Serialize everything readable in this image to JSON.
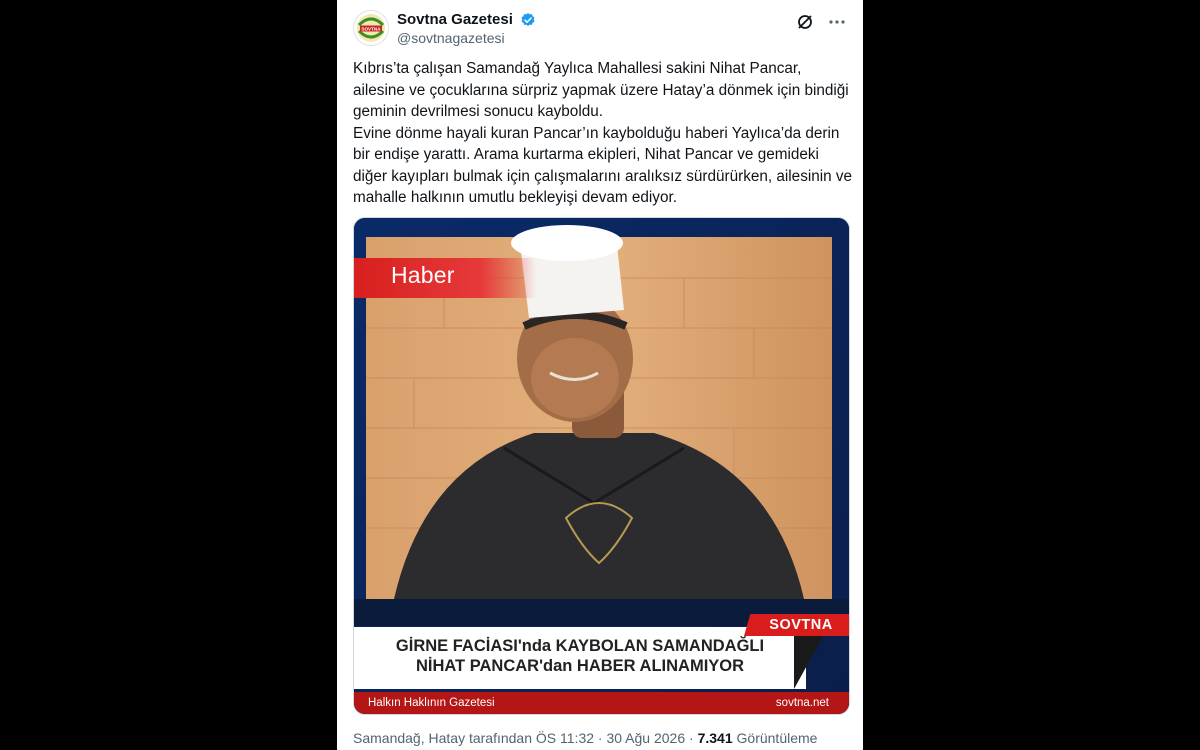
{
  "tweet": {
    "display_name": "Sovtna Gazetesi",
    "handle": "@sovtnagazetesi",
    "avatar_text": "SOVTNA",
    "paragraphs": [
      "Kıbrıs’ta çalışan Samandağ Yaylıca Mahallesi sakini Nihat Pancar, ailesine ve çocuklarına sürpriz yapmak üzere Hatay’a dönmek için bindiği geminin devrilmesi sonucu kayboldu.",
      "Evine dönme hayali kuran Pancar’ın kaybolduğu haberi Yaylıca’da derin bir endişe yarattı. Arama kurtarma ekipleri, Nihat Pancar ve gemideki diğer kayıpları bulmak için çalışmalarını aralıksız sürdürürken, ailesinin ve mahalle halkının umutlu bekleyişi devam ediyor."
    ],
    "meta": {
      "location": "Samandağ, Hatay tarafından",
      "time": "ÖS 11:32",
      "date": "30 Ağu 2026",
      "views": "7.341",
      "views_label": "Görüntüleme",
      "separator": "·"
    },
    "icons": [
      "verified-badge-icon",
      "grok-icon",
      "more-options-icon"
    ]
  },
  "media": {
    "tag": "Haber",
    "brand_badge": "SOVTNA",
    "headline_line1": "GİRNE FACİASI'nda KAYBOLAN SAMANDAĞLI",
    "headline_line2": "NİHAT PANCAR'dan HABER ALINAMIYOR",
    "footer_left": "Halkın Haklının Gazetesi",
    "footer_right": "sovtna.net"
  },
  "colors": {
    "verified": "#1d9bf0",
    "brand_red": "#d91c1c",
    "frame_blue": "#0c2b66",
    "muted": "#536471",
    "text": "#0f1419"
  }
}
